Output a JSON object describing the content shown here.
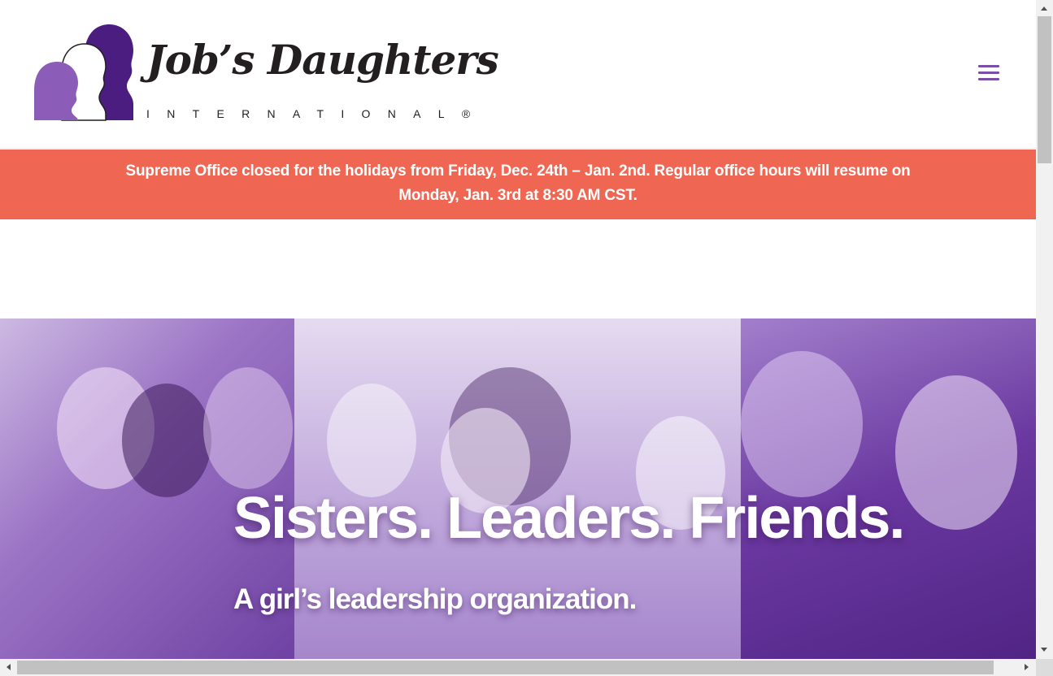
{
  "header": {
    "logo": {
      "script_text": "Job’s Daughters",
      "sub_text": "INTERNATIONAL®",
      "silhouette_colors": [
        "#8c5db8",
        "#ffffff",
        "#4b1d80"
      ]
    },
    "menu_icon": "hamburger-icon",
    "accent_color": "#7b4fa8"
  },
  "notice": {
    "line1": "Supreme Office closed for the holidays from Friday, Dec. 24th – Jan. 2nd. Regular office hours will resume on",
    "line2": "Monday, Jan. 3rd at 8:30 AM CST.",
    "background_color": "#ef6652"
  },
  "hero": {
    "title": "Sisters. Leaders. Friends.",
    "subtitle": "A girl’s leadership organization.",
    "overlay_color": "#6a38a0"
  },
  "scrollbars": {
    "vertical_up_icon": "arrow-up-icon",
    "vertical_down_icon": "arrow-down-icon",
    "horizontal_left_icon": "arrow-left-icon",
    "horizontal_right_icon": "arrow-right-icon"
  }
}
